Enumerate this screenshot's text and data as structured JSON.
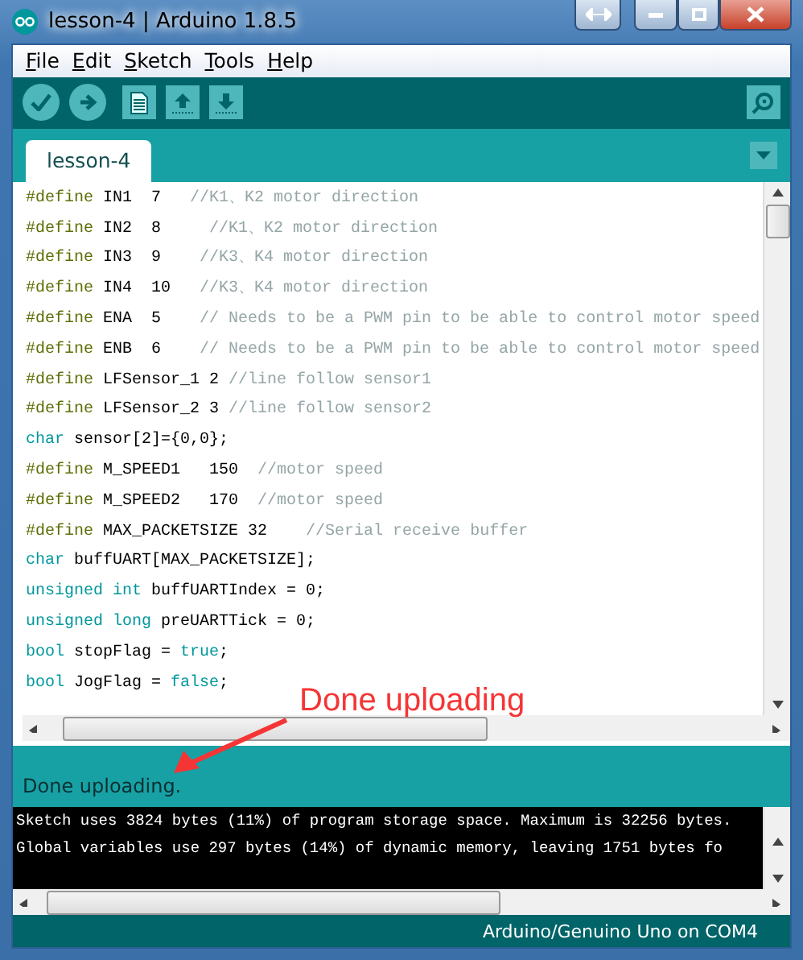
{
  "window": {
    "title": "lesson-4 | Arduino 1.8.5"
  },
  "menu": [
    {
      "label": "File"
    },
    {
      "label": "Edit"
    },
    {
      "label": "Sketch"
    },
    {
      "label": "Tools"
    },
    {
      "label": "Help"
    }
  ],
  "toolbar": [
    {
      "kind": "verify"
    },
    {
      "kind": "upload"
    },
    {
      "kind": "new"
    },
    {
      "kind": "open"
    },
    {
      "kind": "save"
    }
  ],
  "tabs": [
    {
      "label": "lesson-4",
      "selected": true
    }
  ],
  "code": [
    {
      "tokens": [
        {
          "kind": "directive",
          "text": "#define"
        },
        {
          "kind": "plain",
          "text": " IN1  7   "
        },
        {
          "kind": "comment",
          "text": "//K1、K2 motor direction"
        }
      ]
    },
    {
      "tokens": [
        {
          "kind": "directive",
          "text": "#define"
        },
        {
          "kind": "plain",
          "text": " IN2  8     "
        },
        {
          "kind": "comment",
          "text": "//K1、K2 motor direction"
        }
      ]
    },
    {
      "tokens": [
        {
          "kind": "directive",
          "text": "#define"
        },
        {
          "kind": "plain",
          "text": " IN3  9    "
        },
        {
          "kind": "comment",
          "text": "//K3、K4 motor direction"
        }
      ]
    },
    {
      "tokens": [
        {
          "kind": "directive",
          "text": "#define"
        },
        {
          "kind": "plain",
          "text": " IN4  10   "
        },
        {
          "kind": "comment",
          "text": "//K3、K4 motor direction"
        }
      ]
    },
    {
      "tokens": [
        {
          "kind": "directive",
          "text": "#define"
        },
        {
          "kind": "plain",
          "text": " ENA  5    "
        },
        {
          "kind": "comment",
          "text": "// Needs to be a PWM pin to be able to control motor speed"
        }
      ]
    },
    {
      "tokens": [
        {
          "kind": "directive",
          "text": "#define"
        },
        {
          "kind": "plain",
          "text": " ENB  6    "
        },
        {
          "kind": "comment",
          "text": "// Needs to be a PWM pin to be able to control motor speed"
        }
      ]
    },
    {
      "tokens": [
        {
          "kind": "directive",
          "text": "#define"
        },
        {
          "kind": "plain",
          "text": " LFSensor_1 2 "
        },
        {
          "kind": "comment",
          "text": "//line follow sensor1"
        }
      ]
    },
    {
      "tokens": [
        {
          "kind": "directive",
          "text": "#define"
        },
        {
          "kind": "plain",
          "text": " LFSensor_2 3 "
        },
        {
          "kind": "comment",
          "text": "//line follow sensor2"
        }
      ]
    },
    {
      "tokens": [
        {
          "kind": "keyword",
          "text": "char"
        },
        {
          "kind": "plain",
          "text": " sensor[2]={0,0};"
        }
      ]
    },
    {
      "tokens": [
        {
          "kind": "directive",
          "text": "#define"
        },
        {
          "kind": "plain",
          "text": " M_SPEED1   150  "
        },
        {
          "kind": "comment",
          "text": "//motor speed"
        }
      ]
    },
    {
      "tokens": [
        {
          "kind": "directive",
          "text": "#define"
        },
        {
          "kind": "plain",
          "text": " M_SPEED2   170  "
        },
        {
          "kind": "comment",
          "text": "//motor speed"
        }
      ]
    },
    {
      "tokens": [
        {
          "kind": "directive",
          "text": "#define"
        },
        {
          "kind": "plain",
          "text": " MAX_PACKETSIZE 32    "
        },
        {
          "kind": "comment",
          "text": "//Serial receive buffer"
        }
      ]
    },
    {
      "tokens": [
        {
          "kind": "keyword",
          "text": "char"
        },
        {
          "kind": "plain",
          "text": " buffUART[MAX_PACKETSIZE];"
        }
      ]
    },
    {
      "tokens": [
        {
          "kind": "keyword",
          "text": "unsigned int"
        },
        {
          "kind": "plain",
          "text": " buffUARTIndex = 0;"
        }
      ]
    },
    {
      "tokens": [
        {
          "kind": "keyword",
          "text": "unsigned long"
        },
        {
          "kind": "plain",
          "text": " preUARTTick = 0;"
        }
      ]
    },
    {
      "tokens": [
        {
          "kind": "keyword",
          "text": "bool"
        },
        {
          "kind": "plain",
          "text": " stopFlag = "
        },
        {
          "kind": "keyword",
          "text": "true"
        },
        {
          "kind": "plain",
          "text": ";"
        }
      ]
    },
    {
      "tokens": [
        {
          "kind": "keyword",
          "text": "bool"
        },
        {
          "kind": "plain",
          "text": " JogFlag = "
        },
        {
          "kind": "keyword",
          "text": "false"
        },
        {
          "kind": "plain",
          "text": ";"
        }
      ]
    }
  ],
  "annotation": {
    "text": "Done uploading"
  },
  "status": "Done uploading.",
  "console": [
    "Sketch uses 3824 bytes (11%) of program storage space. Maximum is 32256 bytes.",
    "Global variables use 297 bytes (14%) of dynamic memory, leaving 1751 bytes fo"
  ],
  "footer": "Arduino/Genuino Uno on COM4"
}
